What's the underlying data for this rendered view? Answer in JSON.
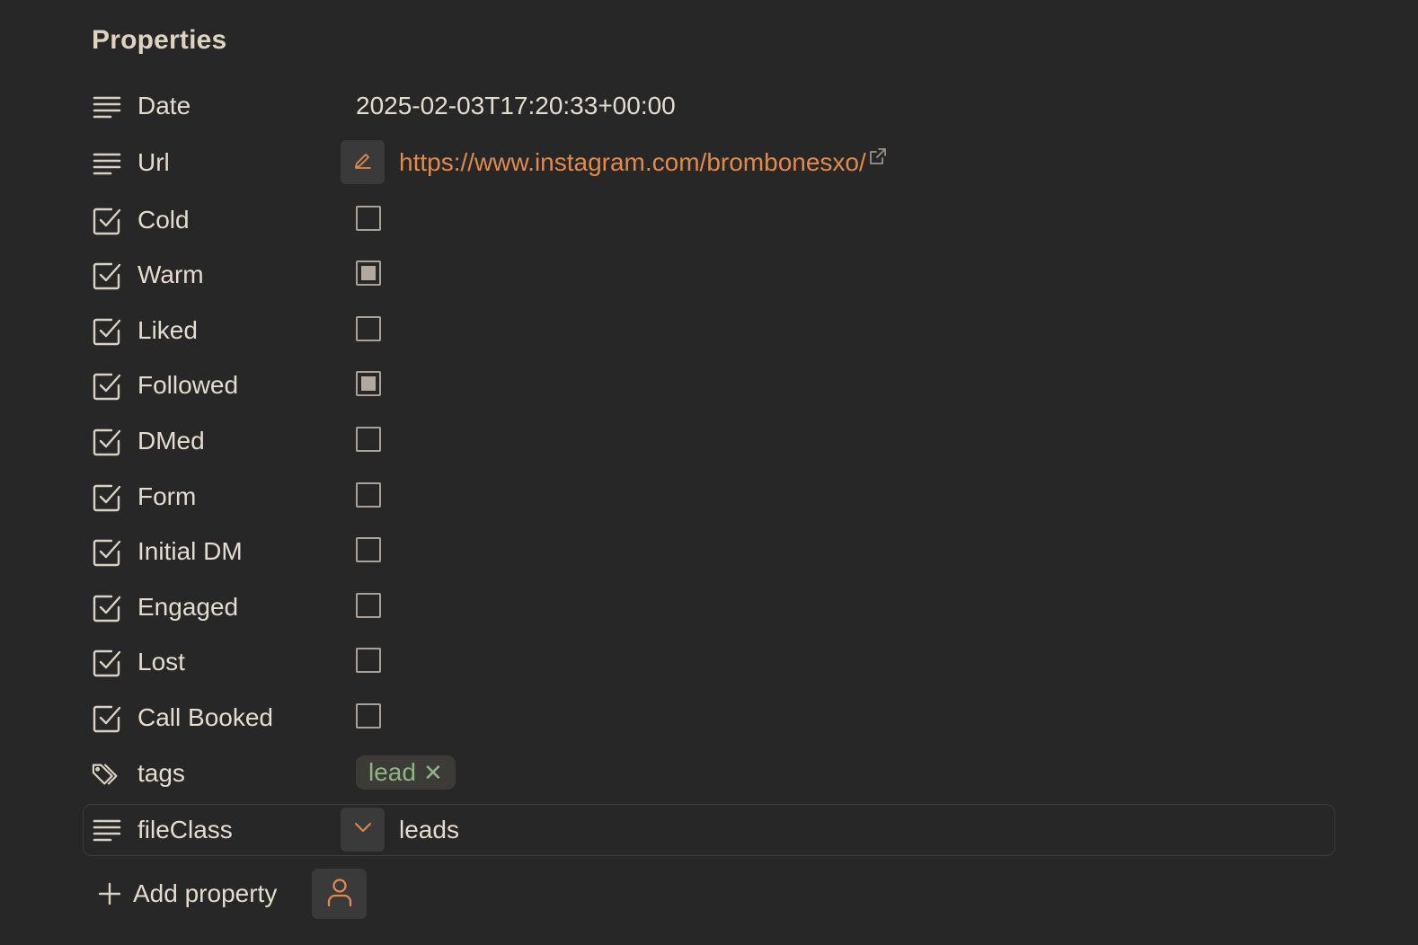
{
  "panel": {
    "heading": "Properties",
    "colors": {
      "background": "#272727",
      "text": "#e3dccf",
      "accent": "#e08a4e",
      "tag_text": "#8eb486",
      "tag_bg": "#3d3b37"
    }
  },
  "properties": [
    {
      "key": "Date",
      "type": "text",
      "icon": "lines-icon",
      "value": "2025-02-03T17:20:33+00:00"
    },
    {
      "key": "Url",
      "type": "link",
      "icon": "lines-icon",
      "value": "https://www.instagram.com/brombonesxo/"
    },
    {
      "key": "Cold",
      "type": "checkbox",
      "icon": "checkbox-icon",
      "checked": false
    },
    {
      "key": "Warm",
      "type": "checkbox",
      "icon": "checkbox-icon",
      "checked": true
    },
    {
      "key": "Liked",
      "type": "checkbox",
      "icon": "checkbox-icon",
      "checked": false
    },
    {
      "key": "Followed",
      "type": "checkbox",
      "icon": "checkbox-icon",
      "checked": true
    },
    {
      "key": "DMed",
      "type": "checkbox",
      "icon": "checkbox-icon",
      "checked": false
    },
    {
      "key": "Form",
      "type": "checkbox",
      "icon": "checkbox-icon",
      "checked": false
    },
    {
      "key": "Initial DM",
      "type": "checkbox",
      "icon": "checkbox-icon",
      "checked": false
    },
    {
      "key": "Engaged",
      "type": "checkbox",
      "icon": "checkbox-icon",
      "checked": false
    },
    {
      "key": "Lost",
      "type": "checkbox",
      "icon": "checkbox-icon",
      "checked": false
    },
    {
      "key": "Call Booked",
      "type": "checkbox",
      "icon": "checkbox-icon",
      "checked": false
    },
    {
      "key": "tags",
      "type": "tags",
      "icon": "tags-icon",
      "tags": [
        "lead"
      ]
    },
    {
      "key": "fileClass",
      "type": "select",
      "icon": "lines-icon",
      "value": "leads"
    }
  ],
  "footer": {
    "add_label": "Add property",
    "add_icon": "plus-icon",
    "extra_icon": "person-icon"
  }
}
